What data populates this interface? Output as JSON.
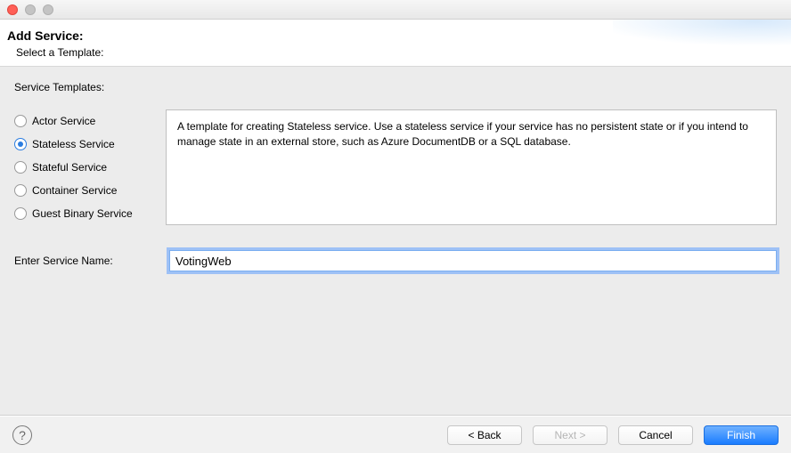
{
  "header": {
    "title": "Add Service:",
    "subtitle": "Select a Template:"
  },
  "section": {
    "label": "Service Templates:"
  },
  "radios": {
    "items": [
      {
        "label": "Actor Service"
      },
      {
        "label": "Stateless Service"
      },
      {
        "label": "Stateful Service"
      },
      {
        "label": "Container Service"
      },
      {
        "label": "Guest Binary Service"
      }
    ],
    "selected_index": 1
  },
  "description": "A template for creating Stateless service.  Use a stateless service if your service has no persistent state or if you intend to manage state in an external store, such as Azure DocumentDB or a SQL database.",
  "service_name": {
    "label": "Enter Service Name:",
    "value": "VotingWeb"
  },
  "buttons": {
    "back": "< Back",
    "next": "Next >",
    "cancel": "Cancel",
    "finish": "Finish"
  }
}
